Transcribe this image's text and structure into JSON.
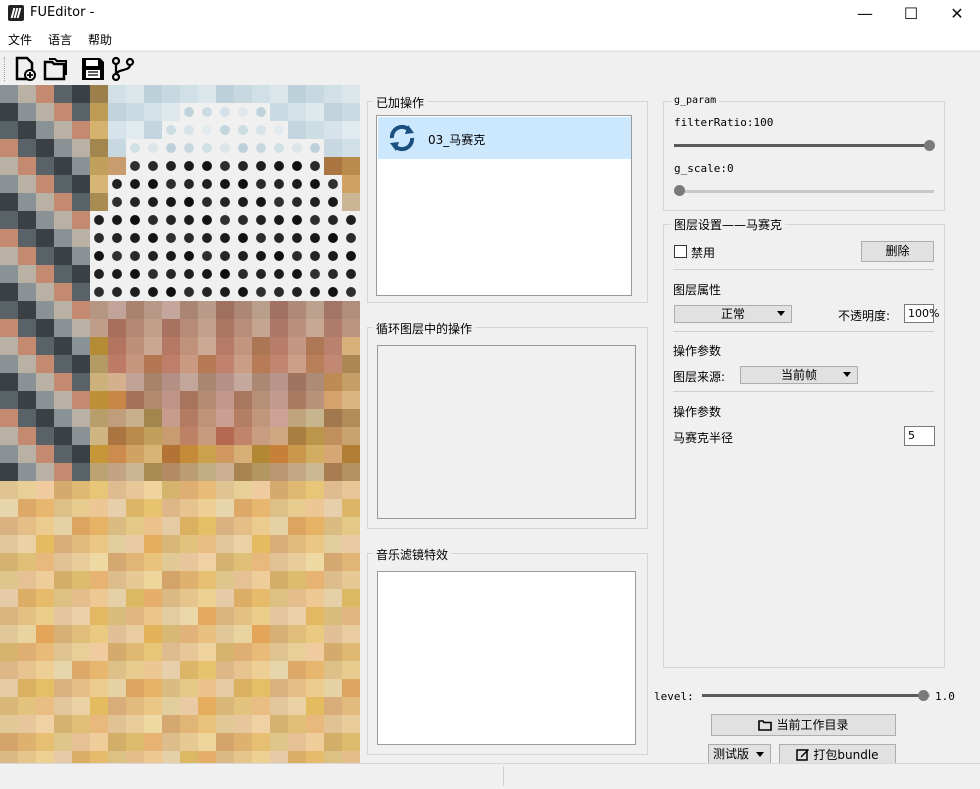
{
  "window": {
    "title": "FUEditor -",
    "minimize": "—",
    "maximize": "☐",
    "close": "✕"
  },
  "menu": [
    "文件",
    "语言",
    "帮助"
  ],
  "toolbar": {
    "icons": [
      "new-file-icon",
      "open-folder-icon",
      "save-icon",
      "branch-icon"
    ]
  },
  "panels": {
    "added_ops": {
      "title": "已加操作",
      "items": [
        {
          "label": "03_马赛克",
          "icon": "refresh-icon",
          "selected": true
        }
      ]
    },
    "loop_layer_ops": {
      "title": "循环图层中的操作"
    },
    "music_filter": {
      "title": "音乐滤镜特效"
    }
  },
  "g_param": {
    "title": "g_param",
    "filter_ratio_label": "filterRatio:100",
    "filter_ratio_value": 100,
    "g_scale_label": "g_scale:0",
    "g_scale_value": 0
  },
  "layer_settings": {
    "title": "图层设置——马赛克",
    "disable_label": "禁用",
    "disable_checked": false,
    "delete_label": "删除",
    "layer_props_label": "图层属性",
    "blend_mode": "正常",
    "opacity_label": "不透明度:",
    "opacity_value": "100%",
    "op_params_label_1": "操作参数",
    "layer_source_label": "图层来源:",
    "layer_source_value": "当前帧",
    "op_params_label_2": "操作参数",
    "mosaic_radius_label": "马赛克半径",
    "mosaic_radius_value": "5"
  },
  "level": {
    "label": "level:",
    "value_text": "1.0",
    "value": 1.0
  },
  "buttons": {
    "workdir": "当前工作目录",
    "version": "测试版",
    "pack": "打包bundle"
  },
  "colors": {
    "selection": "#cce8ff",
    "accent_icon": "#1a4f80"
  }
}
